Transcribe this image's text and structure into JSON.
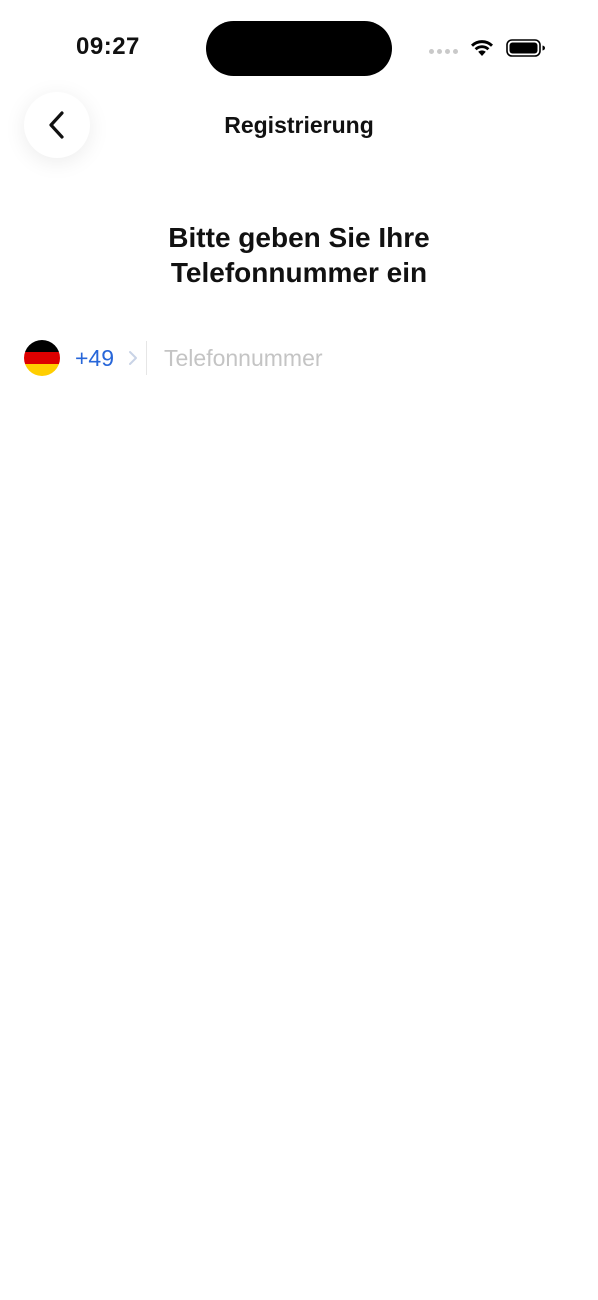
{
  "status_bar": {
    "time": "09:27"
  },
  "nav": {
    "back_icon": "chevron-left-icon",
    "title": "Registrierung"
  },
  "heading": {
    "line1": "Bitte geben Sie Ihre",
    "line2": "Telefonnummer ein"
  },
  "phone": {
    "country_flag": "germany-flag-icon",
    "country_code": "+49",
    "placeholder": "Telefonnummer",
    "value": ""
  },
  "colors": {
    "accent": "#2766d9",
    "placeholder": "#c4c4c4",
    "flag_black": "#000000",
    "flag_red": "#dd0000",
    "flag_gold": "#ffce00"
  }
}
